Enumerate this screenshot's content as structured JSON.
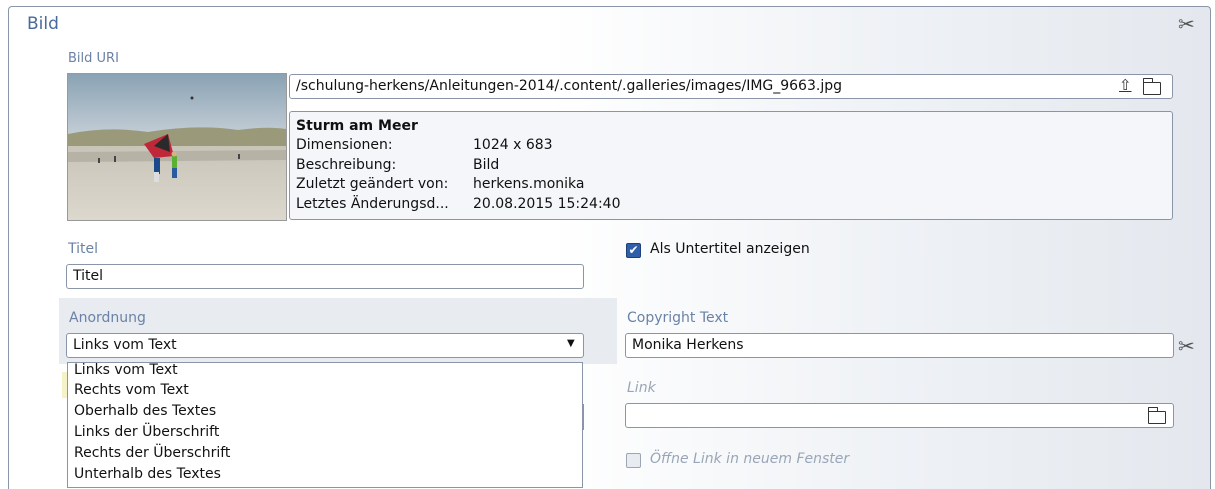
{
  "section": {
    "title": "Bild"
  },
  "image": {
    "uri_label": "Bild URI",
    "uri_value": "/schulung-herkens/Anleitungen-2014/.content/.galleries/images/IMG_9663.jpg",
    "upload_icon": "upload-icon",
    "folder_icon": "folder-icon",
    "info": {
      "title": "Sturm am Meer",
      "rows": [
        {
          "key": "Dimensionen:",
          "value": "1024 x 683"
        },
        {
          "key": "Beschreibung:",
          "value": "Bild"
        },
        {
          "key": "Zuletzt geändert von:",
          "value": "herkens.monika"
        },
        {
          "key": "Letztes Änderungsd...",
          "value": "20.08.2015 15:24:40"
        }
      ]
    }
  },
  "title_field": {
    "label": "Titel",
    "value": "Titel"
  },
  "subtitle_checkbox": {
    "label": "Als Untertitel anzeigen",
    "checked": true
  },
  "arrangement": {
    "label": "Anordnung",
    "selected": "Links vom Text",
    "options": [
      "Links vom Text",
      "Rechts vom Text",
      "Oberhalb des Textes",
      "Links der Überschrift",
      "Rechts der Überschrift",
      "Unterhalb des Textes"
    ]
  },
  "copyright": {
    "label": "Copyright Text",
    "value": "Monika Herkens"
  },
  "link": {
    "label": "Link",
    "value": ""
  },
  "new_window": {
    "label": "Öffne Link in neuem Fenster",
    "checked": false
  },
  "icons": {
    "scissor": "scissor-icon"
  },
  "colors": {
    "label": "#6a82a6",
    "border": "#8a96a8",
    "checkbox": "#2f5fa8"
  }
}
